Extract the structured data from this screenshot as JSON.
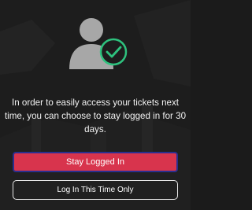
{
  "dialog": {
    "icon": "user-check-icon",
    "message": "In order to easily access your tickets next time, you can choose to stay logged in for 30 days.",
    "primary_button": "Stay Logged In",
    "secondary_button": "Log In This Time Only"
  },
  "colors": {
    "primary_button": "#d8344d",
    "primary_border": "#2a2f8f",
    "check_accent": "#2ec27e",
    "avatar_gray": "#a7a7a7",
    "background": "#1c1c1c"
  }
}
